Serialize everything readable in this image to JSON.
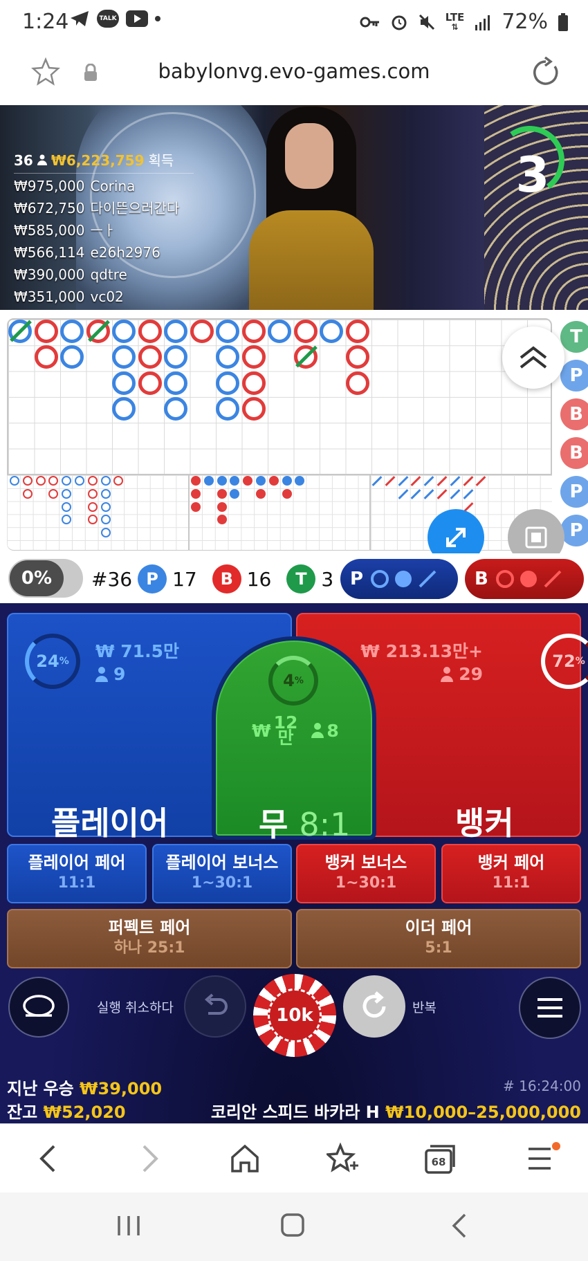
{
  "status": {
    "time": "1:24",
    "talk_badge": "TALK",
    "network": "LTE",
    "battery": "72%"
  },
  "browser": {
    "url": "babylonvg.evo-games.com",
    "tab_count": "68"
  },
  "video": {
    "countdown": "3",
    "summary": {
      "winners_count": "36",
      "total": "₩6,223,759",
      "suffix": "획득"
    },
    "winners": [
      {
        "amount": "₩975,000",
        "name": "Corina"
      },
      {
        "amount": "₩672,750",
        "name": "다이뜬으러간다"
      },
      {
        "amount": "₩585,000",
        "name": "ㅡㅏ"
      },
      {
        "amount": "₩566,114",
        "name": "e26h2976"
      },
      {
        "amount": "₩390,000",
        "name": "qdtre"
      },
      {
        "amount": "₩351,000",
        "name": "vc02"
      }
    ]
  },
  "roadmap": {
    "side_letters": [
      "T",
      "P",
      "B",
      "B",
      "P",
      "P"
    ],
    "colors": {
      "player": "#3b85e2",
      "banker": "#e23b3b",
      "tie": "#1e9a4a"
    }
  },
  "stats": {
    "percent": "0%",
    "round": "#36",
    "player_label": "P",
    "player_count": "17",
    "banker_label": "B",
    "banker_count": "16",
    "tie_label": "T",
    "tie_count": "3",
    "predict_player": "P",
    "predict_banker": "B"
  },
  "bets": {
    "player": {
      "pct": "24",
      "pct_sign": "%",
      "amount": "₩ 71.5만",
      "players": "9",
      "label": "플레이어"
    },
    "banker": {
      "pct": "72",
      "pct_sign": "%",
      "amount": "₩ 213.13만+",
      "players": "29",
      "label": "뱅커"
    },
    "tie": {
      "pct": "4",
      "pct_sign": "%",
      "amount_currency": "₩",
      "amount_num": "12",
      "amount_unit": "만",
      "players": "8",
      "label": "무",
      "odds": "8:1"
    },
    "side": [
      {
        "label": "플레이어 페어",
        "odds": "11:1"
      },
      {
        "label": "플레이어 보너스",
        "odds": "1~30:1"
      },
      {
        "label": "뱅커 보너스",
        "odds": "1~30:1"
      },
      {
        "label": "뱅커 페어",
        "odds": "11:1"
      }
    ],
    "perfect_pair": {
      "label": "퍼펙트 페어",
      "odds": "하나 25:1"
    },
    "either_pair": {
      "label": "이더 페어",
      "odds": "5:1"
    }
  },
  "controls": {
    "undo_label": "실행 취소하다",
    "chip_value": "10k",
    "repeat_label": "반복"
  },
  "footer": {
    "last_win_label": "지난 우승",
    "last_win": "₩39,000",
    "balance_label": "잔고",
    "balance": "₩52,020",
    "game_id": "# 16:24:00",
    "table_name": "코리안 스피드 바카라 H",
    "limits": "₩10,000–25,000,000"
  }
}
